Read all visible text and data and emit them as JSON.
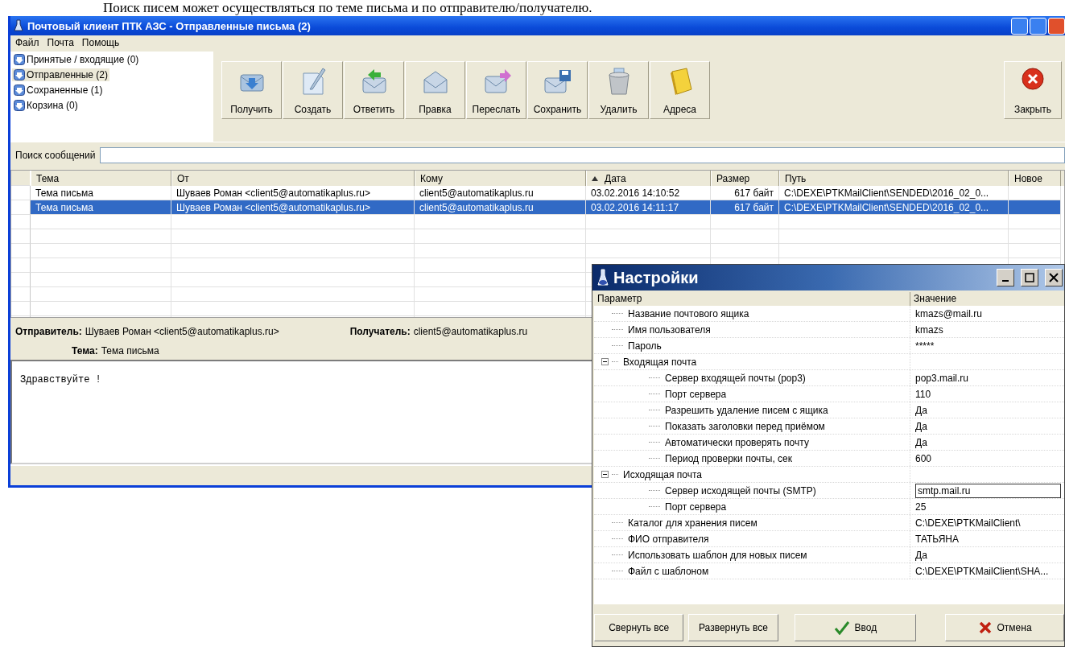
{
  "document_text": "Поиск писем может осуществляться по теме письма и по отправителю/получателю.",
  "window": {
    "title": "Почтовый клиент ПТК АЗС -  Отправленные письма (2)"
  },
  "menu": [
    "Файл",
    "Почта",
    "Помощь"
  ],
  "folders": [
    {
      "label": "Принятые / входящие (0)",
      "selected": false
    },
    {
      "label": "Отправленные (2)",
      "selected": true
    },
    {
      "label": "Сохраненные (1)",
      "selected": false
    },
    {
      "label": "Корзина (0)",
      "selected": false
    }
  ],
  "toolbar": [
    {
      "label": "Получить"
    },
    {
      "label": "Создать"
    },
    {
      "label": "Ответить"
    },
    {
      "label": "Правка"
    },
    {
      "label": "Переслать"
    },
    {
      "label": "Сохранить"
    },
    {
      "label": "Удалить"
    },
    {
      "label": "Адреса"
    }
  ],
  "close_button": {
    "label": "Закрыть"
  },
  "search": {
    "label": "Поиск сообщений"
  },
  "table": {
    "columns": [
      {
        "label": "Тема",
        "sorted": false
      },
      {
        "label": "От",
        "sorted": false
      },
      {
        "label": "Кому",
        "sorted": false
      },
      {
        "label": "Дата",
        "sorted": true
      },
      {
        "label": "Размер",
        "sorted": false
      },
      {
        "label": "Путь",
        "sorted": false
      },
      {
        "label": "Новое",
        "sorted": false
      }
    ],
    "rows": [
      {
        "selected": false,
        "cells": [
          "Тема письма",
          "Шуваев Роман <client5@automatikaplus.ru>",
          "client5@automatikaplus.ru",
          "03.02.2016 14:10:52",
          "617 байт",
          "C:\\DEXE\\PTKMailClient\\SENDED\\2016_02_0..."
        ]
      },
      {
        "selected": true,
        "cells": [
          "Тема письма",
          "Шуваев Роман <client5@automatikaplus.ru>",
          "client5@automatikaplus.ru",
          "03.02.2016 14:11:17",
          "617 байт",
          "C:\\DEXE\\PTKMailClient\\SENDED\\2016_02_0..."
        ]
      }
    ]
  },
  "preview": {
    "sender_label": "Отправитель:",
    "sender": "Шуваев Роман <client5@automatikaplus.ru>",
    "recipient_label": "Получатель:",
    "recipient": "client5@automatikaplus.ru",
    "subject_label": "Тема:",
    "subject": "Тема письма",
    "body": "Здравствуйте !"
  },
  "settings": {
    "title": "Настройки",
    "columns": [
      "Параметр",
      "Значение"
    ],
    "rows": [
      {
        "kind": "item",
        "label": "Название почтового ящика",
        "value": "kmazs@mail.ru",
        "editing": false
      },
      {
        "kind": "item",
        "label": "Имя пользователя",
        "value": "kmazs",
        "editing": false
      },
      {
        "kind": "item",
        "label": "Пароль",
        "value": "*****",
        "editing": false
      },
      {
        "kind": "group",
        "label": "Входящая почта",
        "expanded": true,
        "children": [
          {
            "kind": "item",
            "label": "Сервер входящей почты (pop3)",
            "value": "pop3.mail.ru",
            "editing": false
          },
          {
            "kind": "item",
            "label": "Порт сервера",
            "value": "110",
            "editing": false
          },
          {
            "kind": "item",
            "label": "Разрешить удаление писем с ящика",
            "value": "Да",
            "editing": false
          },
          {
            "kind": "item",
            "label": "Показать заголовки перед приёмом",
            "value": "Да",
            "editing": false
          },
          {
            "kind": "item",
            "label": "Автоматически проверять почту",
            "value": "Да",
            "editing": false
          },
          {
            "kind": "item",
            "label": "Период проверки почты, сек",
            "value": "600",
            "editing": false
          }
        ]
      },
      {
        "kind": "group",
        "label": "Исходящая почта",
        "expanded": true,
        "children": [
          {
            "kind": "item",
            "label": "Сервер исходящей почты (SMTP)",
            "value": "smtp.mail.ru",
            "editing": true
          },
          {
            "kind": "item",
            "label": "Порт сервера",
            "value": "25",
            "editing": false
          }
        ]
      },
      {
        "kind": "item",
        "label": "Каталог для хранения писем",
        "value": "C:\\DEXE\\PTKMailClient\\",
        "editing": false
      },
      {
        "kind": "item",
        "label": "ФИО отправителя",
        "value": "ТАТЬЯНА",
        "editing": false
      },
      {
        "kind": "item",
        "label": "Использовать шаблон для новых писем",
        "value": "Да",
        "editing": false
      },
      {
        "kind": "item",
        "label": "Файл с шаблоном",
        "value": "C:\\DEXE\\PTKMailClient\\SHA...",
        "editing": false
      }
    ],
    "buttons": [
      {
        "label": "Свернуть все"
      },
      {
        "label": "Развернуть все"
      },
      {
        "label": "Ввод"
      },
      {
        "label": "Отмена"
      }
    ]
  }
}
